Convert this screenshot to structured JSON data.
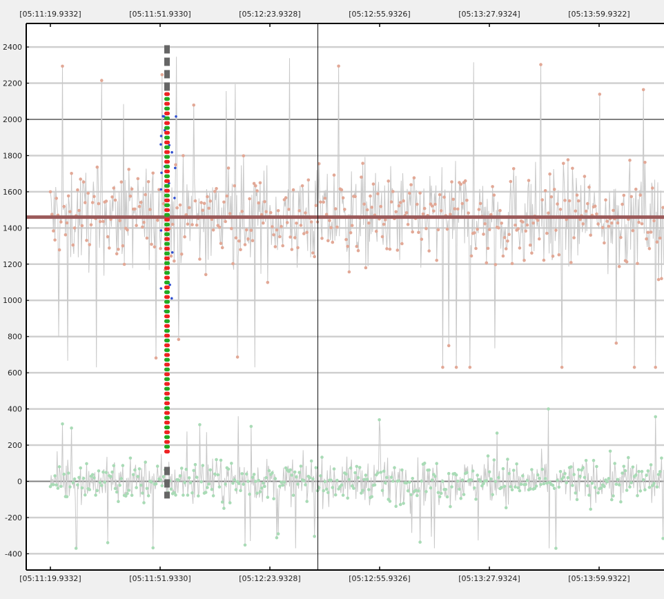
{
  "chart_data": {
    "type": "line",
    "title": "",
    "xlabel": "",
    "ylabel": "",
    "x_tick_labels": [
      "[05:11:19.9332]",
      "[05:11:51.9330]",
      "[05:12:23.9328]",
      "[05:12:55.9326]",
      "[05:13:27.9324]",
      "[05:13:59.9322]"
    ],
    "y_ticks": [
      -400,
      -200,
      0,
      200,
      400,
      600,
      800,
      1000,
      1200,
      1400,
      1600,
      1800,
      2000,
      2200,
      2400
    ],
    "ylim": [
      -490,
      2530
    ],
    "grid": true,
    "legend": "none",
    "series": [
      {
        "color": "#e2a896",
        "line_color": "#c8c8c8",
        "approx_mean": 1460,
        "approx_min": 630,
        "approx_max": 2410
      },
      {
        "color": "#a9dbb6",
        "line_color": "#c8c8c8",
        "approx_mean": 0,
        "approx_min": -370,
        "approx_max": 400
      },
      {
        "color": "#2f4fd0",
        "approx_min": 930,
        "approx_max": 2040
      }
    ],
    "reference_lines": {
      "horizontal_mean": 1460,
      "horizontal_mean_color": "#9b5a5a",
      "zero_line": 0,
      "emphasized_grid": [
        0,
        2000
      ]
    },
    "marked_column": {
      "x_label": "[05:11:51.9330]",
      "dash_colors": [
        "#ee2222",
        "#22aa22"
      ],
      "dash_range": [
        150,
        2150
      ],
      "grey_upper_range": [
        2150,
        2410
      ],
      "grey_lower_range": [
        -95,
        80
      ],
      "grey_color": "#666666"
    },
    "cursor": {
      "x_position": "between [05:12:23.9328] and [05:12:55.9326]"
    }
  }
}
